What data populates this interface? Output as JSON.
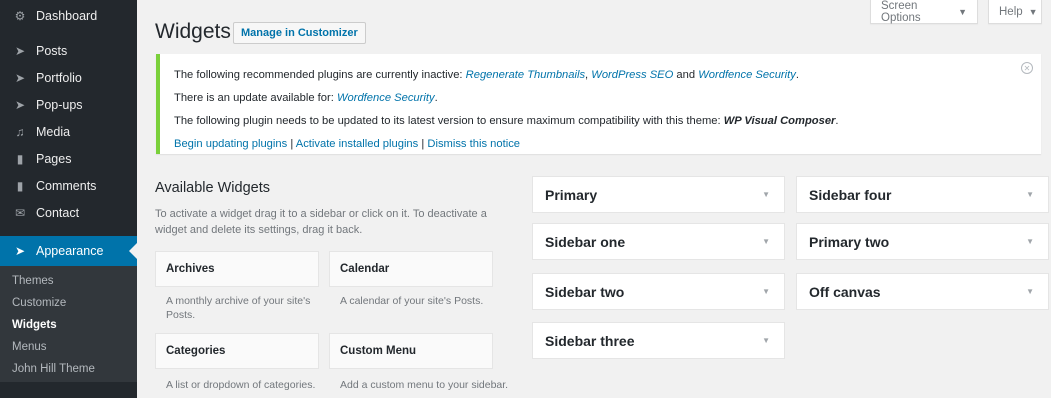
{
  "menu": {
    "items": [
      {
        "label": "Dashboard",
        "icon": "dashboard-icon"
      },
      {
        "label": "Posts",
        "icon": "pin-icon"
      },
      {
        "label": "Portfolio",
        "icon": "pin-icon"
      },
      {
        "label": "Pop-ups",
        "icon": "pin-icon"
      },
      {
        "label": "Media",
        "icon": "media-icon"
      },
      {
        "label": "Pages",
        "icon": "page-icon"
      },
      {
        "label": "Comments",
        "icon": "comment-icon"
      },
      {
        "label": "Contact",
        "icon": "mail-icon"
      },
      {
        "label": "Appearance",
        "icon": "brush-icon"
      }
    ],
    "submenu": [
      "Themes",
      "Customize",
      "Widgets",
      "Menus",
      "John Hill Theme"
    ]
  },
  "topbar": {
    "screen_options": "Screen Options",
    "help": "Help"
  },
  "page": {
    "title": "Widgets",
    "manage_customizer": "Manage in Customizer"
  },
  "notice": {
    "line1_prefix": "The following recommended plugins are currently inactive: ",
    "line1_plugin1": "Regenerate Thumbnails",
    "line1_sep1": ", ",
    "line1_plugin2": "WordPress SEO",
    "line1_and": " and ",
    "line1_plugin3": "Wordfence Security",
    "line1_end": ".",
    "line2_prefix": "There is an update available for: ",
    "line2_plugin": "Wordfence Security",
    "line2_end": ".",
    "line3_prefix": "The following plugin needs to be updated to its latest version to ensure maximum compatibility with this theme: ",
    "line3_plugin": "WP Visual Composer",
    "line3_end": ".",
    "link_begin": "Begin updating plugins",
    "link_activate": "Activate installed plugins",
    "link_dismiss": "Dismiss this notice",
    "sep": " | "
  },
  "available": {
    "title": "Available Widgets",
    "description": "To activate a widget drag it to a sidebar or click on it. To deactivate a widget and delete its settings, drag it back.",
    "widgets": [
      {
        "name": "Archives",
        "desc": "A monthly archive of your site's Posts."
      },
      {
        "name": "Calendar",
        "desc": "A calendar of your site's Posts."
      },
      {
        "name": "Categories",
        "desc": "A list or dropdown of categories."
      },
      {
        "name": "Custom Menu",
        "desc": "Add a custom menu to your sidebar."
      }
    ]
  },
  "sidebars": {
    "col1": [
      "Primary",
      "Sidebar one",
      "Sidebar two",
      "Sidebar three"
    ],
    "col2": [
      "Sidebar four",
      "Primary two",
      "Off canvas"
    ]
  },
  "colors": {
    "sidebar_bg": "#23282d",
    "accent": "#0073aa",
    "notice_border": "#7ad03a"
  }
}
